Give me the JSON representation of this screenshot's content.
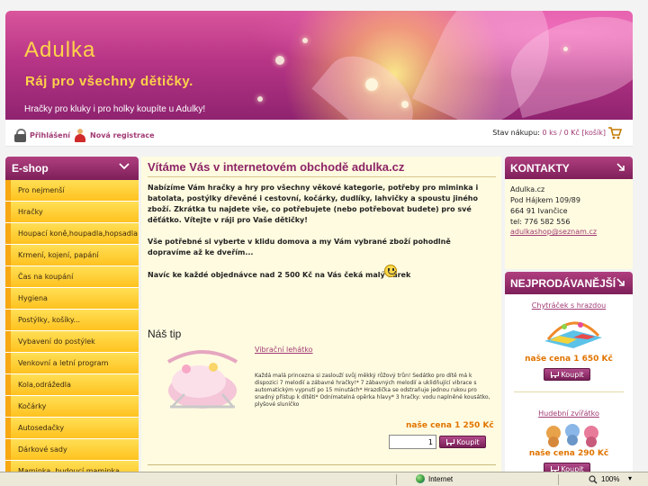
{
  "header": {
    "brand": "Adulka",
    "slogan": "Ráj pro všechny dětičky.",
    "tagline": "Hračky pro kluky i pro holky koupíte u Adulky!"
  },
  "topbar": {
    "login": "Přihlášení",
    "register": "Nová registrace",
    "cart_label": "Stav nákupu:",
    "cart_value": "0 ks / 0 Kč [košík]"
  },
  "eshop": {
    "title": "E-shop",
    "categories": [
      "Pro nejmenší",
      "Hračky",
      "Houpací koně,houpadla,hopsadla",
      "Krmení, kojení, papání",
      "Čas na koupání",
      "Hygiena",
      "Postýlky, košíky...",
      "Vybavení do postýlek",
      "Venkovní a letní program",
      "Kola,odrážedla",
      "Kočárky",
      "Autosedačky",
      "Dárkové sady",
      "Maminka, budoucí maminka"
    ]
  },
  "main": {
    "title": "Vítáme Vás v internetovém obchodě adulka.cz",
    "intro": "Nabízíme Vám hračky a hry pro všechny věkové kategorie, potřeby pro miminka i batolata, postýlky dřevěné i cestovní, kočárky, dudlíky, lahvičky a spoustu jiného zboží. Zkrátka tu najdete vše, co potřebujete (nebo potřebovat budete) pro své děťátko. Vítejte v ráji pro Vaše dětičky!",
    "intro2": "Vše potřebné si vyberte v klidu domova a my Vám vybrané zboží pohodlně dopravíme až ke dveřím...",
    "intro3": "Navíc ke každé objednávce nad 2 500 Kč na Vás čeká malý dárek",
    "tip_heading": "Náš tip",
    "tip": {
      "name": "Vibrační lehátko",
      "description": "Každá malá princezna si zaslouží svůj měkký růžový trůn! Sedátko pro dítě má k dispozici 7 melodií a zábavné hračky!* 7 zábavných melodií a uklidňující vibrace s automatickým vypnutí po 15 minutách* Hrazdička se odstraňuje jednou rukou pro snadný přístup k dítěti* Odnímatelná opěrka hlavy* 3 hračky: vodu naplněné kousátko, plyšové sluníčko",
      "price": "naše cena 1 250 Kč",
      "qty": "1",
      "buy_label": "Koupit"
    }
  },
  "contacts": {
    "title": "KONTAKTY",
    "lines": [
      "Adulka.cz",
      "Pod Hájkem 109/89",
      "664 91 Ivančice",
      "tel: 776 582 556"
    ],
    "email": "adulkashop@seznam.cz"
  },
  "bestsellers": {
    "title": "NEJPRODÁVANĚJŠÍ",
    "items": [
      {
        "name": "Chytráček s hrazdou",
        "price": "naše cena 1 650 Kč",
        "buy_label": "Koupit"
      },
      {
        "name": "Hudební zvířátko",
        "price": "naše cena 290 Kč",
        "buy_label": "Koupit"
      }
    ]
  },
  "statusbar": {
    "zone": "Internet",
    "zoom": "100%"
  },
  "colors": {
    "accent": "#8c2466",
    "link": "#a13a74",
    "price": "#e07400",
    "category_bg": "#ffc21f"
  }
}
